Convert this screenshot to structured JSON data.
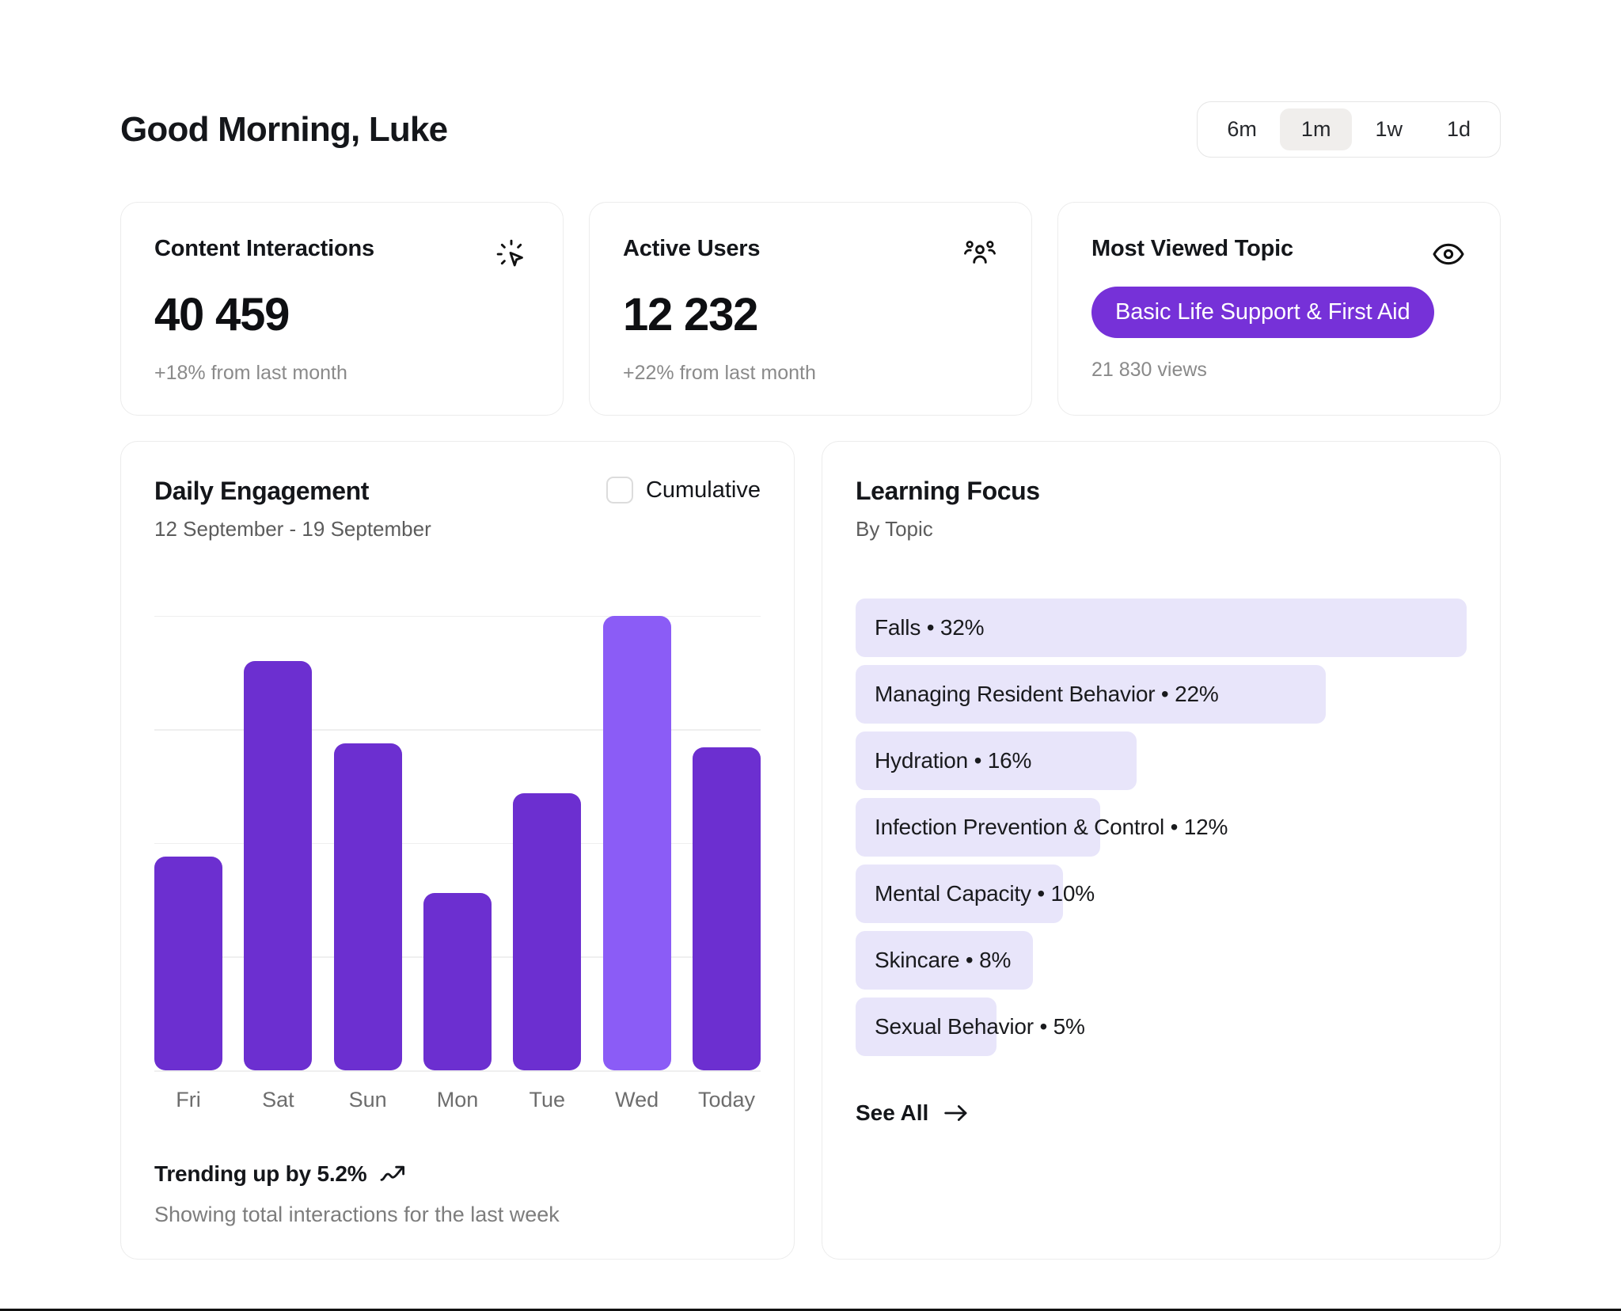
{
  "header": {
    "greeting": "Good Morning, Luke",
    "ranges": [
      {
        "label": "6m",
        "active": false
      },
      {
        "label": "1m",
        "active": true
      },
      {
        "label": "1w",
        "active": false
      },
      {
        "label": "1d",
        "active": false
      }
    ]
  },
  "kpis": [
    {
      "title": "Content Interactions",
      "value": "40 459",
      "sub": "+18% from last month",
      "icon": "cursor-click-icon"
    },
    {
      "title": "Active Users",
      "value": "12 232",
      "sub": "+22% from last month",
      "icon": "users-group-icon"
    },
    {
      "title": "Most Viewed Topic",
      "pill": "Basic Life Support & First Aid",
      "sub": "21 830 views",
      "icon": "eye-icon"
    }
  ],
  "engagement": {
    "title": "Daily Engagement",
    "subtitle": "12 September - 19 September",
    "cumulative_label": "Cumulative",
    "cumulative_checked": false,
    "trend": "Trending up by 5.2%",
    "trend_note": "Showing total interactions for the last week"
  },
  "chart_data": {
    "type": "bar",
    "title": "Daily Engagement",
    "subtitle": "12 September - 19 September",
    "categories": [
      "Fri",
      "Sat",
      "Sun",
      "Mon",
      "Tue",
      "Wed",
      "Today"
    ],
    "values": [
      47,
      90,
      72,
      39,
      61,
      100,
      71
    ],
    "highlight_index": 5,
    "xlabel": "",
    "ylabel": "",
    "ylim": [
      0,
      108
    ],
    "grid": true,
    "gridlines": [
      25,
      50,
      75,
      100
    ],
    "legend": "none",
    "bar_color": "#6C2FD0",
    "highlight_color": "#8B5CF6"
  },
  "learning_focus": {
    "title": "Learning Focus",
    "subtitle": "By Topic",
    "see_all": "See All",
    "topics": [
      {
        "label": "Falls • 32%",
        "width_pct": 100
      },
      {
        "label": "Managing Resident Behavior • 22%",
        "width_pct": 77
      },
      {
        "label": "Hydration • 16%",
        "width_pct": 46
      },
      {
        "label": "Infection Prevention & Control • 12%",
        "width_pct": 40
      },
      {
        "label": "Mental Capacity • 10%",
        "width_pct": 34
      },
      {
        "label": "Skincare • 8%",
        "width_pct": 29
      },
      {
        "label": "Sexual Behavior • 5%",
        "width_pct": 23
      }
    ]
  },
  "colors": {
    "accent_purple": "#7631D8",
    "bar_purple": "#6C2FD0",
    "bar_purple_light": "#8B5CF6",
    "topic_lavender": "#E8E5FA"
  }
}
